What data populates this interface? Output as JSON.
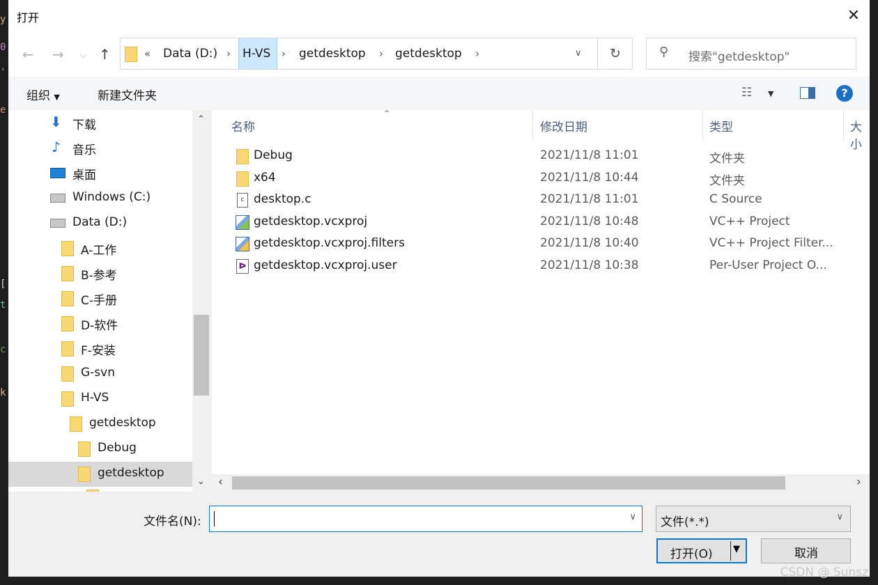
{
  "window": {
    "title": "打开",
    "close_glyph": "✕"
  },
  "address": {
    "overflow": "«",
    "crumbs": [
      "Data (D:)",
      "H-VS",
      "getdesktop",
      "getdesktop"
    ]
  },
  "search": {
    "placeholder": "搜索\"getdesktop\""
  },
  "toolbar": {
    "organize": "组织",
    "new_folder": "新建文件夹"
  },
  "sidebar": {
    "items": [
      {
        "label": "下载",
        "icon": "download-icon"
      },
      {
        "label": "音乐",
        "icon": "music-icon"
      },
      {
        "label": "桌面",
        "icon": "desktop-icon"
      },
      {
        "label": "Windows (C:)",
        "icon": "windows-drive-icon"
      },
      {
        "label": "Data (D:)",
        "icon": "drive-icon"
      },
      {
        "label": "A-工作",
        "icon": "folder-icon"
      },
      {
        "label": "B-参考",
        "icon": "folder-icon"
      },
      {
        "label": "C-手册",
        "icon": "folder-icon"
      },
      {
        "label": "D-软件",
        "icon": "folder-icon"
      },
      {
        "label": "F-安装",
        "icon": "folder-icon"
      },
      {
        "label": "G-svn",
        "icon": "folder-icon"
      },
      {
        "label": "H-VS",
        "icon": "folder-icon"
      },
      {
        "label": "getdesktop",
        "icon": "folder-icon"
      },
      {
        "label": "Debug",
        "icon": "folder-icon"
      },
      {
        "label": "getdesktop",
        "icon": "folder-icon",
        "selected": true
      }
    ]
  },
  "columns": {
    "name": "名称",
    "date": "修改日期",
    "type": "类型",
    "size": "大小"
  },
  "files": [
    {
      "name": "Debug",
      "date": "2021/11/8 11:01",
      "type": "文件夹",
      "icon": "folder-icon"
    },
    {
      "name": "x64",
      "date": "2021/11/8 10:44",
      "type": "文件夹",
      "icon": "folder-icon"
    },
    {
      "name": "desktop.c",
      "date": "2021/11/8 11:01",
      "type": "C Source",
      "icon": "c-source-file-icon"
    },
    {
      "name": "getdesktop.vcxproj",
      "date": "2021/11/8 10:48",
      "type": "VC++ Project",
      "icon": "vcxproj-file-icon"
    },
    {
      "name": "getdesktop.vcxproj.filters",
      "date": "2021/11/8 10:40",
      "type": "VC++ Project Filter...",
      "icon": "filters-file-icon"
    },
    {
      "name": "getdesktop.vcxproj.user",
      "date": "2021/11/8 10:38",
      "type": "Per-User Project O...",
      "icon": "vs-user-file-icon"
    }
  ],
  "bottom": {
    "filename_label": "文件名(N):",
    "filename_value": "",
    "filter_value": "文件(*.*)",
    "open_label": "打开(O)",
    "cancel_label": "取消"
  },
  "watermark": "CSDN @ Sunsz"
}
